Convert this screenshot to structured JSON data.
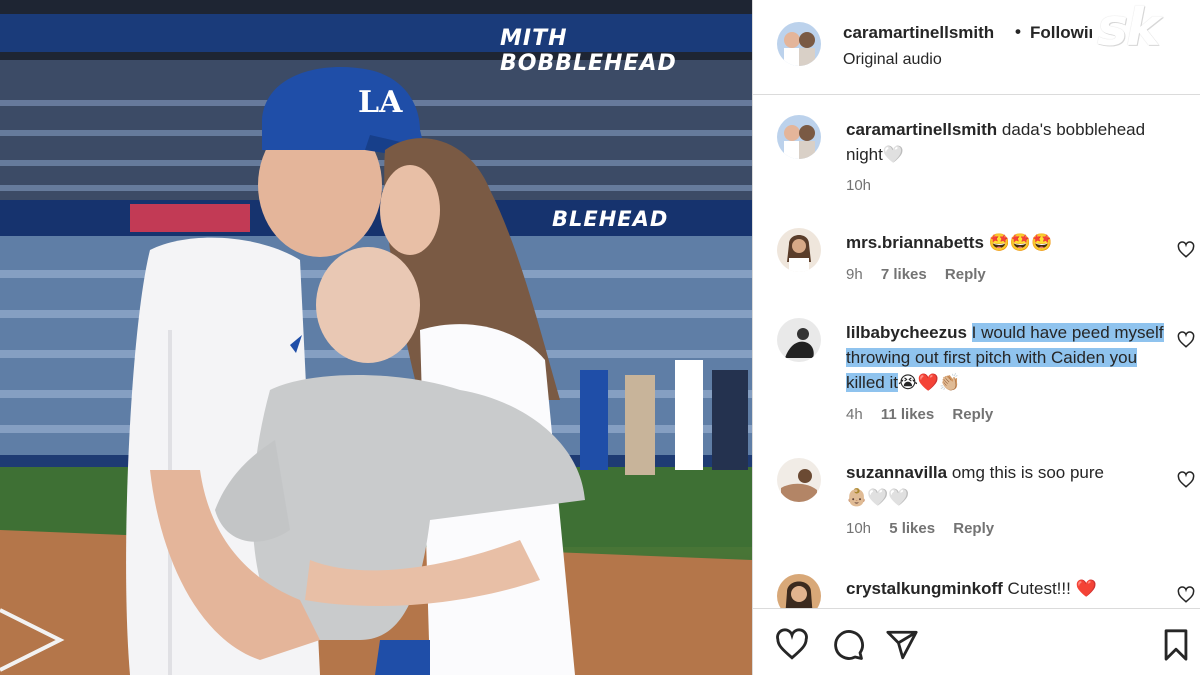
{
  "photo": {
    "banner_top": "MITH BOBBLEHEAD",
    "banner_mid": "BLEHEAD",
    "cap_logo": "LA"
  },
  "header": {
    "username": "caramartinellsmith",
    "dot": "•",
    "follow": "Following",
    "audio": "Original audio",
    "watermark": "sk"
  },
  "caption": {
    "username": "caramartinellsmith",
    "text": "dada's bobblehead night",
    "emoji": "🤍",
    "time": "10h"
  },
  "comments": [
    {
      "username": "mrs.briannabetts",
      "text": "🤩🤩🤩",
      "time": "9h",
      "likes": "7 likes",
      "reply": "Reply"
    },
    {
      "username": "lilbabycheezus",
      "text": "I would have peed myself throwing out first pitch with Caiden you killed it",
      "emoji": "😭❤️👏🏼",
      "time": "4h",
      "likes": "11 likes",
      "reply": "Reply"
    },
    {
      "username": "suzannavilla",
      "text": "omg this is soo pure",
      "emoji": "👶🏼🤍🤍",
      "time": "10h",
      "likes": "5 likes",
      "reply": "Reply"
    },
    {
      "username": "crystalkungminkoff",
      "text": "Cutest!!!",
      "emoji": "❤️"
    }
  ],
  "icons": [
    "heart-icon",
    "comment-icon",
    "share-icon",
    "bookmark-icon"
  ],
  "colors": {
    "highlight": "#8fc3ee",
    "dodger_blue": "#1f4ea8",
    "red": "#e0245e"
  }
}
